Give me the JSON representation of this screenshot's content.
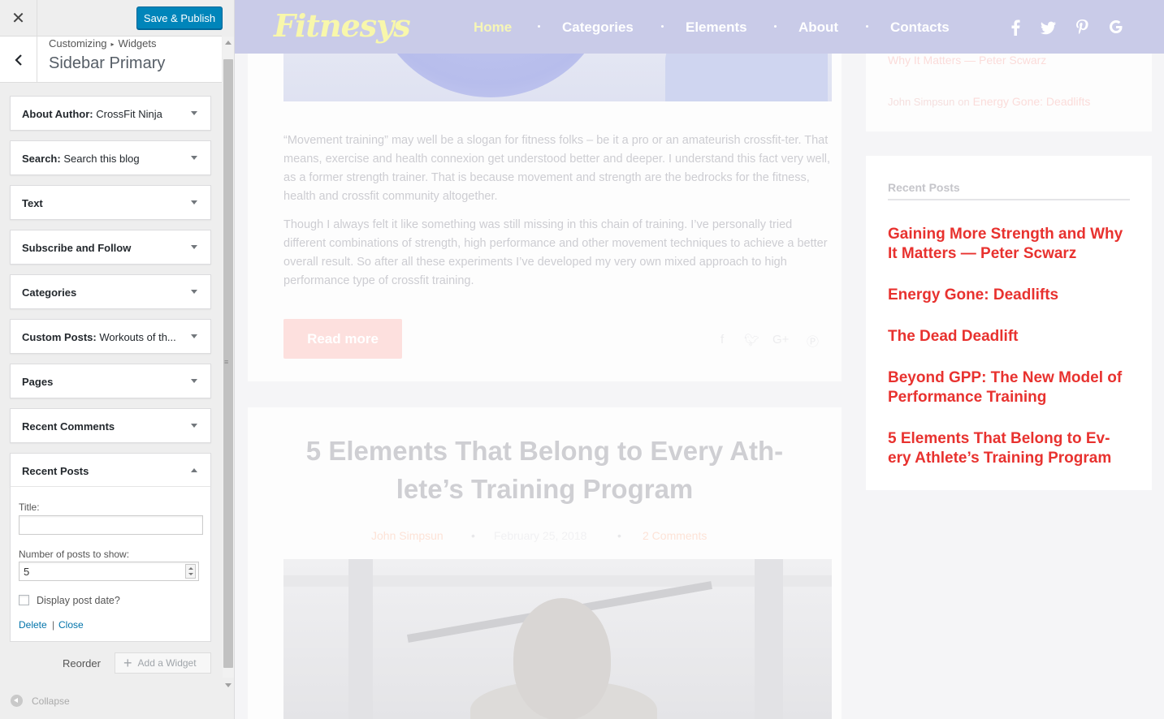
{
  "customizer": {
    "save_label": "Save & Publish",
    "breadcrumb": [
      "Customizing",
      "Widgets"
    ],
    "section_title": "Sidebar Primary",
    "widgets": [
      {
        "title": "About Author:",
        "instance": "CrossFit Ninja"
      },
      {
        "title": "Search:",
        "instance": "Search this blog"
      },
      {
        "title": "Text",
        "instance": ""
      },
      {
        "title": "Subscribe and Follow",
        "instance": ""
      },
      {
        "title": "Categories",
        "instance": ""
      },
      {
        "title": "Custom Posts:",
        "instance": "Workouts of th..."
      },
      {
        "title": "Pages",
        "instance": ""
      },
      {
        "title": "Recent Comments",
        "instance": ""
      },
      {
        "title": "Recent Posts",
        "instance": ""
      }
    ],
    "form": {
      "title_label": "Title:",
      "title_value": "",
      "count_label": "Number of posts to show:",
      "count_value": "5",
      "date_label": "Display post date?",
      "date_checked": false,
      "delete_label": "Delete",
      "separator": "|",
      "close_label": "Close"
    },
    "reorder_label": "Reorder",
    "add_widget_label": "Add a Widget",
    "collapse_label": "Collapse"
  },
  "site": {
    "logo": "Fitnesys",
    "nav": [
      "Home",
      "Categories",
      "Elements",
      "About",
      "Contacts"
    ],
    "social_icons": [
      "facebook-icon",
      "twitter-icon",
      "pinterest-icon",
      "google-icon"
    ],
    "article": {
      "para1": "“Movement training” may well be a slogan for fitness folks – be it a pro or an amateurish crossfit-ter. That means, exercise and health connexion get understood better and deeper. I understand this fact very well, as a former strength trainer. That is because movement and strength are the bedrocks for the fitness, health and crossfit community altogether.",
      "para2": "Though I always felt it like something was still missing in this chain of training. I’ve personally tried different combinations of strength, high performance and other movement techniques to achieve a better overall result. So after all these experiments I’ve developed my very own mixed approach to high performance type of crossfit training.",
      "read_more": "Read more"
    },
    "article2": {
      "title": "5 Elements That Belong to Every Ath-lete’s Training Program",
      "author": "John Simpsun",
      "date": "February 25, 2018",
      "comments": "2 Comments"
    },
    "recent_comments": {
      "line1": "Why It Matters — Peter Scwarz",
      "line2_author": "John Simpsun",
      "line2_on": "on",
      "line2_post": "Energy Gone: Deadlifts"
    },
    "recent_posts": {
      "heading": "Recent Posts",
      "items": [
        "Gaining More Strength and Why It Matters — Peter Scwarz",
        "Energy Gone: Deadlifts",
        "The Dead Deadlift",
        "Beyond GPP: The New Model of Performance Training",
        "5 Elements That Belong to Ev-ery Athlete’s Training Program"
      ]
    },
    "colors": {
      "accent": "#e8322f",
      "nav_bg": "#c9cbe8",
      "logo": "#f8f7ab",
      "wp_blue": "#0085ba"
    }
  }
}
